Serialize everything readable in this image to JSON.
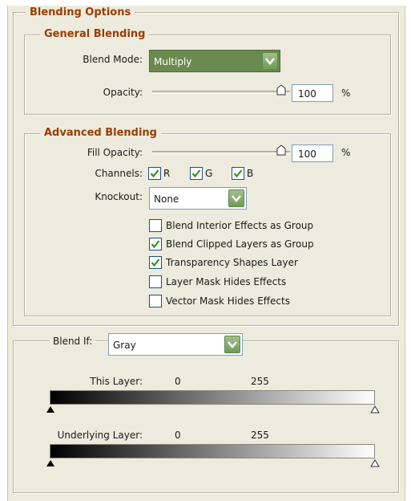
{
  "blending_options": {
    "title": "Blending Options"
  },
  "general_blending": {
    "title": "General Blending",
    "blend_mode_label": "Blend Mode:",
    "blend_mode_value": "Multiply",
    "opacity_label": "Opacity:",
    "opacity_value": "100",
    "opacity_unit": "%",
    "opacity_level": 1.0
  },
  "advanced_blending": {
    "title": "Advanced Blending",
    "fill_opacity_label": "Fill Opacity:",
    "fill_opacity_value": "100",
    "fill_opacity_unit": "%",
    "fill_opacity_level": 1.0,
    "channels_label": "Channels:",
    "channels": [
      {
        "label": "R",
        "checked": true
      },
      {
        "label": "G",
        "checked": true
      },
      {
        "label": "B",
        "checked": true
      }
    ],
    "knockout_label": "Knockout:",
    "knockout_value": "None",
    "options": [
      {
        "label": "Blend Interior Effects as Group",
        "checked": false
      },
      {
        "label": "Blend Clipped Layers as Group",
        "checked": true
      },
      {
        "label": "Transparency Shapes Layer",
        "checked": true
      },
      {
        "label": "Layer Mask Hides Effects",
        "checked": false
      },
      {
        "label": "Vector Mask Hides Effects",
        "checked": false
      }
    ]
  },
  "blend_if": {
    "label": "Blend If:",
    "value": "Gray",
    "this_layer": {
      "label": "This Layer:",
      "low": "0",
      "high": "255"
    },
    "underlying_layer": {
      "label": "Underlying Layer:",
      "low": "0",
      "high": "255"
    }
  },
  "colors": {
    "panel_bg": "#ecebdd",
    "heading": "#9a3d00",
    "selected_field": "#6b8a4f",
    "dropdown_arrow": "#7fa766",
    "checkmark": "#2a9a1e"
  }
}
